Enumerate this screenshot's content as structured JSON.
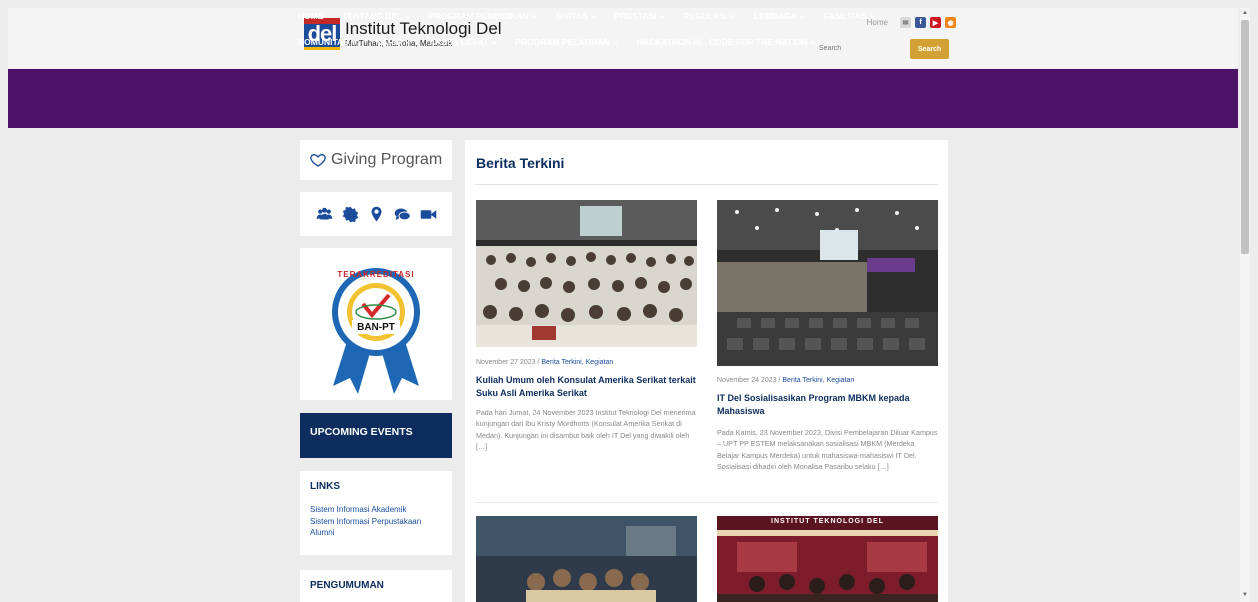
{
  "header": {
    "logo_mark": "del",
    "title": "Institut Teknologi Del",
    "tagline": "MarTuhan, Marroha, Marbisuk",
    "home_link": "Home",
    "search_placeholder": "Search",
    "search_button": "Search",
    "social_icons": [
      "mail-icon",
      "facebook-icon",
      "youtube-icon",
      "rss-icon"
    ]
  },
  "nav": {
    "row1": [
      {
        "label": "HOME",
        "arrow": ""
      },
      {
        "label": "TENTANG DEL",
        "arrow": "»"
      },
      {
        "label": "PROGRAM PENDIDIKAN",
        "arrow": "»"
      },
      {
        "label": "SIVITAS",
        "arrow": "»"
      },
      {
        "label": "PRESTASI",
        "arrow": "»"
      },
      {
        "label": "REGULASI",
        "arrow": "»"
      },
      {
        "label": "LEMBAGA",
        "arrow": "»"
      },
      {
        "label": "FASILITAS",
        "arrow": "»"
      }
    ],
    "row2": [
      {
        "label": "KOMUNITAS",
        "arrow": "»"
      },
      {
        "label": "KARIR",
        "arrow": "»"
      },
      {
        "label": "AKSES CEPAT",
        "arrow": "»"
      },
      {
        "label": "PROGRAM PELATIHAN",
        "arrow": "»"
      },
      {
        "label": "HACKATHON AI : CODE FOR THE NATION",
        "arrow": "»"
      }
    ]
  },
  "sidebar": {
    "giving": "Giving Program",
    "quick_icons": [
      "users-icon",
      "badge-icon",
      "map-pin-icon",
      "chat-icon",
      "video-icon"
    ],
    "accreditation": {
      "top": "TERAKREDITASI",
      "bottom": "BAN-PT"
    },
    "events_title": "UPCOMING EVENTS",
    "links_title": "LINKS",
    "links": [
      "Sistem Informasi Akademik",
      "Sistem Informasi Perpustakaan",
      "Alumni"
    ],
    "announcement_title": "PENGUMUMAN"
  },
  "main": {
    "title": "Berita Terkini",
    "articles": [
      {
        "date": "November 27 2023",
        "sep": " / ",
        "categories": "Berita Terkini, Kegiatan",
        "title": "Kuliah Umum oleh Konsulat Amerika Serikat terkait Suku Asli Amerika Serikat",
        "excerpt": "Pada hari Jumat, 24 November 2023 Institut Teknologi Del menerima kunjungan dari Ibu Kristy Mordhorts (Konsulat Amerika Serikat di Medan). Kunjungan ini disambut baik oleh IT Del yang diwakili oleh […]"
      },
      {
        "date": "November 24 2023",
        "sep": " / ",
        "categories": "Berita Terkini, Kegiatan",
        "title": "IT Del Sosialisasikan Program MBKM kepada Mahasiswa",
        "excerpt": "Pada Kamis, 23 November 2023, Divisi Pembelajaran Diluar Kampus – UPT PP ESTEM melaksanakan sosialisasi MBKM (Merdeka Belajar Kampus Merdeka) untuk mahasiswa-mahasiswi IT Del. Sosialisasi dihadiri oleh Monalisa Pasaribu selaku […]"
      }
    ],
    "banner_text": "INSTITUT TEKNOLOGI DEL"
  },
  "colors": {
    "nav": "#4c1266",
    "navy": "#0d2d5e",
    "accent": "#d2a034",
    "link": "#1b4c9c"
  }
}
